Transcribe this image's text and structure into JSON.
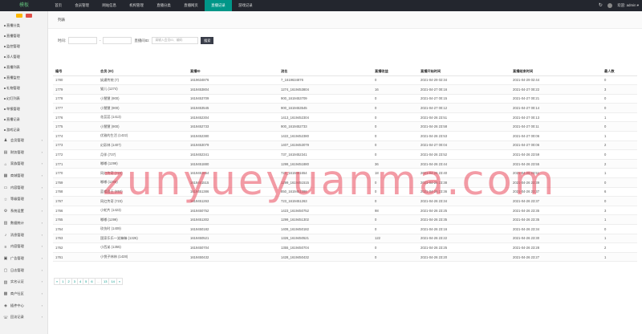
{
  "app": {
    "logo": "模板"
  },
  "topnav": [
    {
      "label": "首页"
    },
    {
      "label": "会员管理"
    },
    {
      "label": "网站信息"
    },
    {
      "label": "机构管理"
    },
    {
      "label": "直播分类"
    },
    {
      "label": "直播网页"
    },
    {
      "label": "直播记录"
    },
    {
      "label": "游戏记录"
    }
  ],
  "topright": {
    "refresh_icon": "refresh-icon",
    "user": "欢迎: admin ▾"
  },
  "sidebar": {
    "items": [
      {
        "label": "直播分类",
        "type": "sub"
      },
      {
        "label": "直播管理",
        "type": "sub"
      },
      {
        "label": "监控管理",
        "type": "sub"
      },
      {
        "label": "添人管理",
        "type": "sub"
      },
      {
        "label": "直播列表",
        "type": "sub"
      },
      {
        "label": "直播监控",
        "type": "sub"
      },
      {
        "label": "礼物管理",
        "type": "sub"
      },
      {
        "label": "幻灯列表",
        "type": "sub"
      },
      {
        "label": "举报管理",
        "type": "sub"
      },
      {
        "label": "直播记录",
        "type": "sub"
      },
      {
        "label": "游戏记录",
        "type": "sub"
      },
      {
        "label": "会员管理",
        "type": "grp",
        "icon": "users-icon"
      },
      {
        "label": "财务管理",
        "type": "grp",
        "icon": "wallet-icon"
      },
      {
        "label": "家族管理",
        "type": "grp",
        "icon": "home-icon"
      },
      {
        "label": "商城管理",
        "type": "grp",
        "icon": "cart-icon"
      },
      {
        "label": "内容管理",
        "type": "grp",
        "icon": "doc-icon"
      },
      {
        "label": "等级管理",
        "type": "grp",
        "icon": "star-icon"
      },
      {
        "label": "系统设置",
        "type": "grp",
        "icon": "gear-icon"
      },
      {
        "label": "数据统计",
        "type": "grp",
        "icon": "chart-icon"
      },
      {
        "label": "消息管理",
        "type": "grp",
        "icon": "bell-icon"
      },
      {
        "label": "内容管理",
        "type": "grp",
        "icon": "list-icon"
      },
      {
        "label": "广告管理",
        "type": "grp",
        "icon": "ad-icon"
      },
      {
        "label": "日志管理",
        "type": "grp",
        "icon": "log-icon"
      },
      {
        "label": "实名认证",
        "type": "grp",
        "icon": "id-icon"
      },
      {
        "label": "商户社区",
        "type": "grp",
        "icon": "shop-icon"
      },
      {
        "label": "插件中心",
        "type": "grp",
        "icon": "plug-icon"
      },
      {
        "label": "回访记录",
        "type": "grp",
        "icon": "phone-icon"
      }
    ]
  },
  "breadcrumb": "列表",
  "filter": {
    "time_label": "时间:",
    "dash": "-",
    "keyword_label": "直播间ID:",
    "keyword_placeholder": "请输入会员ID、编码",
    "search_label": "搜索"
  },
  "table": {
    "headers": [
      "编号",
      "会员 (ID)",
      "直播ID",
      "流名",
      "直播收益",
      "直播开始时间",
      "直播结束时间",
      "最人数"
    ],
    "rows": [
      [
        "1780",
        "妩媚传统 (7)",
        "1619634876",
        "7_1619634876",
        "0",
        "2021-04-29 02:34",
        "2021-04-29 02:44",
        "0"
      ],
      [
        "1779",
        "猫儿 (1274)",
        "1619453804",
        "1274_1619453804",
        "16",
        "2021-04-27 00:16",
        "2021-04-27 00:22",
        "3"
      ],
      [
        "1778",
        "小慧慧 (900)",
        "1619453709",
        "900_1619453709",
        "0",
        "2021-04-27 00:15",
        "2021-04-27 00:21",
        "0"
      ],
      [
        "1777",
        "小慧慧 (900)",
        "1619453545",
        "900_1619453545",
        "0",
        "2021-04-27 00:12",
        "2021-04-27 00:14",
        "0"
      ],
      [
        "1776",
        "花蕊蕊 (1413)",
        "1619452304",
        "1413_1619452304",
        "0",
        "2021-04-26 23:51",
        "2021-04-27 00:13",
        "1"
      ],
      [
        "1775",
        "小慧慧 (900)",
        "1619452733",
        "900_1619452733",
        "0",
        "2021-04-26 23:58",
        "2021-04-27 00:11",
        "0"
      ],
      [
        "1774",
        "优雅的生活 (1422)",
        "1619452380",
        "1422_1619452380",
        "0",
        "2021-04-26 23:53",
        "2021-04-27 00:06",
        "1"
      ],
      [
        "1773",
        "幻彩林 (1407)",
        "1619453079",
        "1407_1619453079",
        "0",
        "2021-04-27 00:04",
        "2021-04-27 00:06",
        "2"
      ],
      [
        "1772",
        "月伴 (737)",
        "1619452341",
        "737_1619452341",
        "0",
        "2021-04-26 23:52",
        "2021-04-26 23:59",
        "0"
      ],
      [
        "1771",
        "嘟嘟 (1299)",
        "1619451880",
        "1299_1619451880",
        "36",
        "2021-04-26 23:44",
        "2021-04-26 23:55",
        "2"
      ],
      [
        "1770",
        "同红传奇 (723)",
        "1619451654",
        "723_1619451654",
        "18",
        "2021-04-26 23:40",
        "2021-04-26 23:51",
        "1"
      ],
      [
        "1769",
        "嘟嘟 (1299)",
        "1619451515",
        "1299_1619451515",
        "0",
        "2021-04-26 23:38",
        "2021-04-26 23:39",
        "0"
      ],
      [
        "1768",
        "蓝蝶君王 (850)",
        "1619451386",
        "850_1619451386",
        "0",
        "2021-04-26 23:36",
        "2021-04-26 23:37",
        "6"
      ],
      [
        "1767",
        "同红传奇 (723)",
        "1619451263",
        "723_1619451263",
        "0",
        "2021-04-26 23:34",
        "2021-04-26 23:37",
        "0"
      ],
      [
        "1766",
        "小蛇片 (1423)",
        "1619450752",
        "1423_1619450752",
        "98",
        "2021-04-26 23:25",
        "2021-04-26 23:35",
        "3"
      ],
      [
        "1765",
        "嘟嘟 (1299)",
        "1619451302",
        "1299_1619451302",
        "0",
        "2021-04-26 23:35",
        "2021-04-26 23:35",
        "1"
      ],
      [
        "1764",
        "玫伤时 (1409)",
        "1619450182",
        "1409_1619450182",
        "0",
        "2021-04-26 23:16",
        "2021-04-26 23:34",
        "0"
      ],
      [
        "1763",
        "国家乐乐一笑嘛嘛 (1326)",
        "1619450521",
        "1326_1619450521",
        "122",
        "2021-04-26 23:22",
        "2021-04-26 23:30",
        "1"
      ],
      [
        "1762",
        "小西弟 (1355)",
        "1619450704",
        "1355_1619450704",
        "0",
        "2021-04-26 23:25",
        "2021-04-26 23:28",
        "2"
      ],
      [
        "1761",
        "小悦子林林 (1428)",
        "1619450432",
        "1428_1619450432",
        "0",
        "2021-04-26 23:20",
        "2021-04-26 23:27",
        "1"
      ]
    ]
  },
  "pagination": [
    "«",
    "1",
    "2",
    "3",
    "4",
    "5",
    "6",
    "...",
    "13",
    "14",
    "»"
  ],
  "watermark": "zunyueyuanma.com"
}
